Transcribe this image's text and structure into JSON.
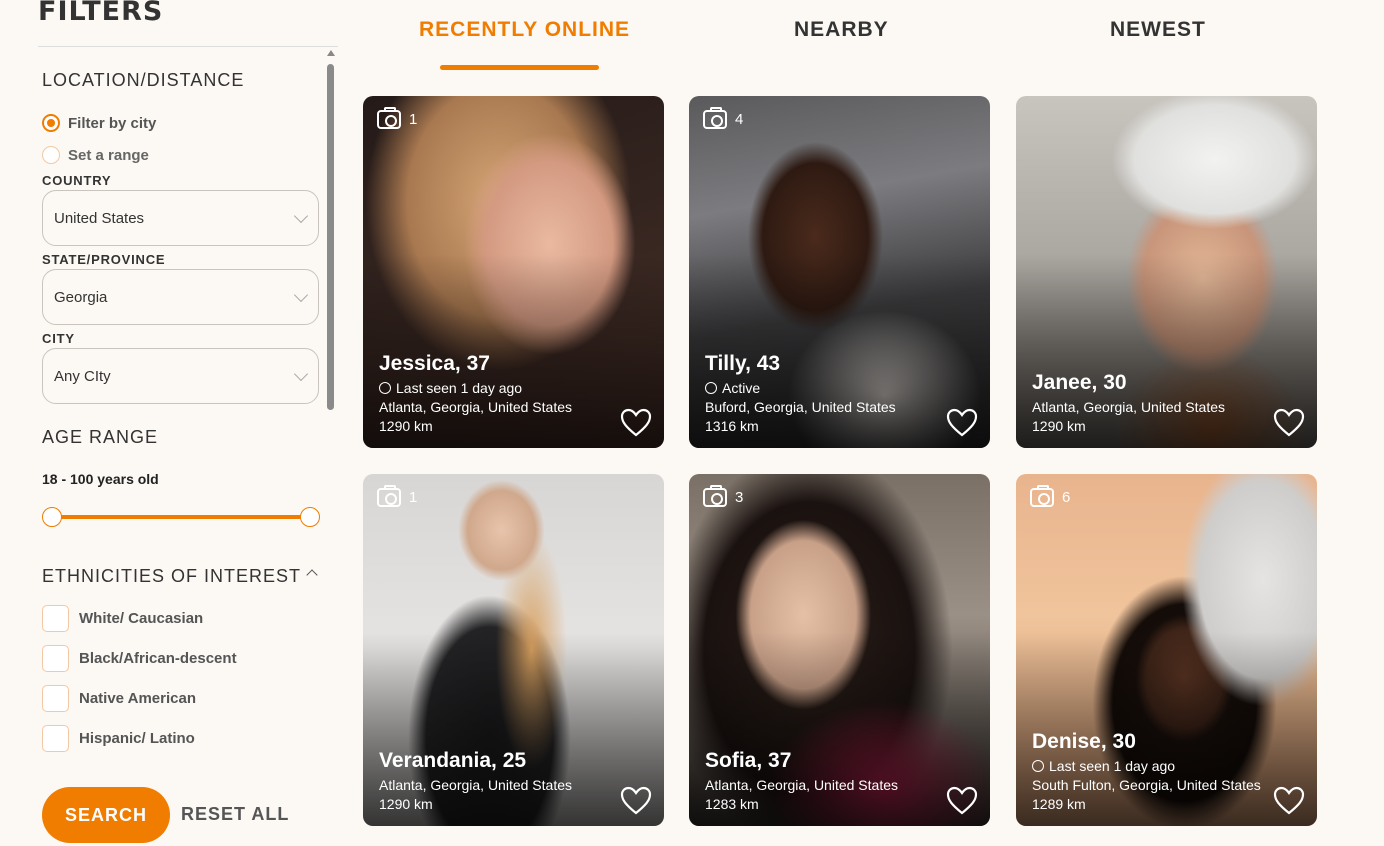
{
  "sidebar": {
    "title": "FILTERS",
    "location_heading": "LOCATION/DISTANCE",
    "radio_filter_city": "Filter by city",
    "radio_set_range": "Set a range",
    "country_label": "COUNTRY",
    "country_value": "United States",
    "state_label": "STATE/PROVINCE",
    "state_value": "Georgia",
    "city_label": "CITY",
    "city_value": "Any CIty",
    "age_heading": "AGE RANGE",
    "age_value": "18 - 100 years old",
    "age_min": 18,
    "age_max": 100,
    "ethnicities_heading": "ETHNICITIES OF INTEREST",
    "ethnicities": [
      "White/ Caucasian",
      "Black/African-descent",
      "Native American",
      "Hispanic/ Latino"
    ],
    "search_label": "SEARCH",
    "reset_label": "RESET ALL"
  },
  "tabs": [
    "RECENTLY ONLINE",
    "NEARBY",
    "NEWEST"
  ],
  "active_tab": "RECENTLY ONLINE",
  "cards": [
    {
      "photos": "1",
      "name": "Jessica, 37",
      "status": "Last seen 1 day ago",
      "location": "Atlanta, Georgia, United States",
      "distance": "1290 km"
    },
    {
      "photos": "4",
      "name": "Tilly, 43",
      "status": "Active",
      "location": "Buford, Georgia, United States",
      "distance": "1316 km"
    },
    {
      "photos": "",
      "name": "Janee, 30",
      "status": "",
      "location": "Atlanta, Georgia, United States",
      "distance": "1290 km"
    },
    {
      "photos": "1",
      "name": "Verandania, 25",
      "status": "",
      "location": "Atlanta, Georgia, United States",
      "distance": "1290 km"
    },
    {
      "photos": "3",
      "name": "Sofia, 37",
      "status": "",
      "location": "Atlanta, Georgia, United States",
      "distance": "1283 km"
    },
    {
      "photos": "6",
      "name": "Denise, 30",
      "status": "Last seen 1 day ago",
      "location": "South Fulton, Georgia, United States",
      "distance": "1289 km"
    }
  ],
  "colors": {
    "accent": "#f07c00",
    "background": "#fcf8f3"
  }
}
